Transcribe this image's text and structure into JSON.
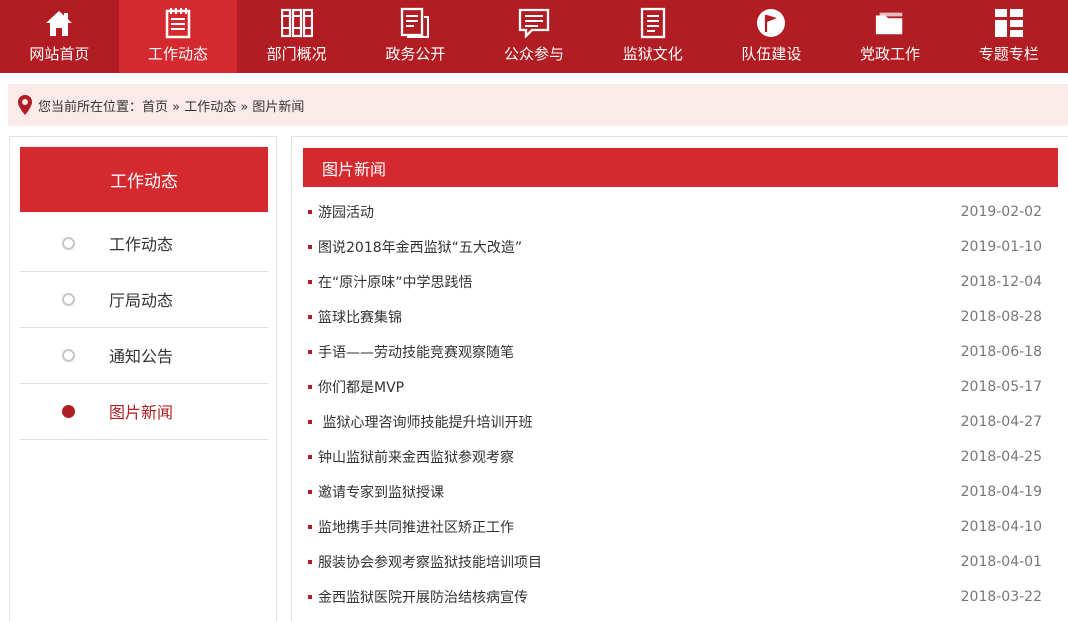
{
  "nav": {
    "items": [
      {
        "label": "网站首页",
        "icon": "home-icon"
      },
      {
        "label": "工作动态",
        "icon": "notepad-icon"
      },
      {
        "label": "部门概况",
        "icon": "binders-icon"
      },
      {
        "label": "政务公开",
        "icon": "document-icon"
      },
      {
        "label": "公众参与",
        "icon": "chat-icon"
      },
      {
        "label": "监狱文化",
        "icon": "page-icon"
      },
      {
        "label": "队伍建设",
        "icon": "flag-icon"
      },
      {
        "label": "党政工作",
        "icon": "folder-icon"
      },
      {
        "label": "专题专栏",
        "icon": "grid-icon"
      }
    ],
    "active_index": 1,
    "bg_color": "#b11d22",
    "active_color": "#d42a2f"
  },
  "breadcrumb": {
    "icon": "location-pin-icon",
    "text": "您当前所在位置：首页 » 工作动态 » 图片新闻"
  },
  "sidebar": {
    "title": "工作动态",
    "items": [
      {
        "label": "工作动态"
      },
      {
        "label": "厅局动态"
      },
      {
        "label": "通知公告"
      },
      {
        "label": "图片新闻"
      }
    ],
    "active_index": 3
  },
  "main": {
    "title": "图片新闻",
    "news": [
      {
        "title": "游园活动",
        "date": "2019-02-02"
      },
      {
        "title": "图说2018年金西监狱“五大改造”",
        "date": "2019-01-10"
      },
      {
        "title": "在“原汁原味”中学思践悟",
        "date": "2018-12-04"
      },
      {
        "title": "篮球比赛集锦",
        "date": "2018-08-28"
      },
      {
        "title": "手语——劳动技能竞赛观察随笔",
        "date": "2018-06-18"
      },
      {
        "title": "你们都是MVP",
        "date": "2018-05-17"
      },
      {
        "title": " 监狱心理咨询师技能提升培训开班",
        "date": "2018-04-27"
      },
      {
        "title": "钟山监狱前来金西监狱参观考察",
        "date": "2018-04-25"
      },
      {
        "title": "邀请专家到监狱授课",
        "date": "2018-04-19"
      },
      {
        "title": "监地携手共同推进社区矫正工作",
        "date": "2018-04-10"
      },
      {
        "title": "服装协会参观考察监狱技能培训项目",
        "date": "2018-04-01"
      },
      {
        "title": "金西监狱医院开展防治结核病宣传",
        "date": "2018-03-22"
      }
    ]
  }
}
